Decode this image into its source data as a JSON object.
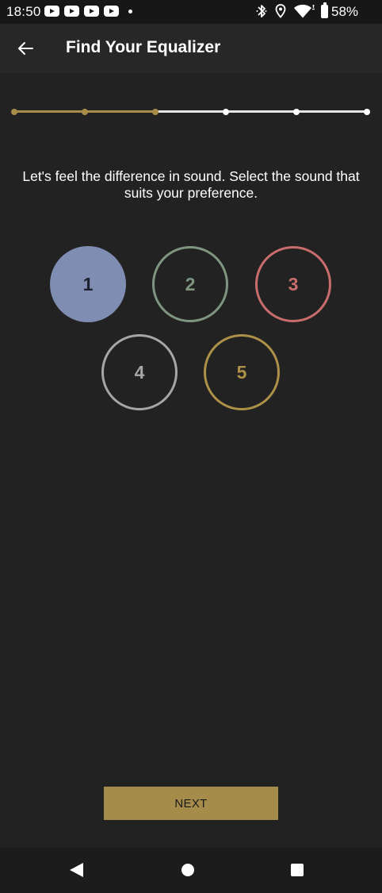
{
  "status_bar": {
    "time": "18:50",
    "notification_icons": [
      "youtube-icon",
      "youtube-icon",
      "youtube-icon",
      "youtube-icon",
      "dot-icon"
    ],
    "system_icons": [
      "bluetooth-icon",
      "location-icon",
      "wifi-icon",
      "battery-icon"
    ],
    "battery_percent": "58%"
  },
  "app_bar": {
    "back_icon": "arrow-left-icon",
    "title": "Find Your Equalizer"
  },
  "progress": {
    "total_steps": 6,
    "current_step": 3,
    "done_color": "#a88c4a",
    "pending_color": "#e6e6e6"
  },
  "instruction": "Let's feel the difference in sound. Select the sound that suits your preference.",
  "options": [
    {
      "label": "1",
      "color": "#7f8db3",
      "selected": true
    },
    {
      "label": "2",
      "color": "#7e9580",
      "selected": false
    },
    {
      "label": "3",
      "color": "#c86d6c",
      "selected": false
    },
    {
      "label": "4",
      "color": "#a6a6a6",
      "selected": false
    },
    {
      "label": "5",
      "color": "#ad9148",
      "selected": false
    }
  ],
  "next_button": {
    "label": "NEXT",
    "color": "#a68c4b"
  },
  "nav_bar": {
    "icons": [
      "back-triangle-icon",
      "home-circle-icon",
      "recents-square-icon"
    ]
  }
}
